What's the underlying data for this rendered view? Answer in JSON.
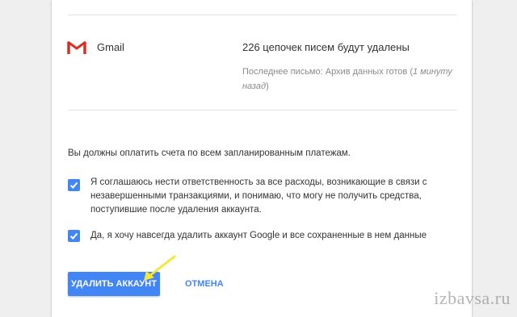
{
  "service": {
    "name": "Gmail",
    "count_text": "226 цепочек писем будут удалены",
    "last_prefix": "Последнее письмо: Архив данных готов (",
    "last_ago": "1 минуту назад",
    "last_suffix": ")"
  },
  "notice": "Вы должны оплатить счета по всем запланированным платежам.",
  "checkboxes": [
    {
      "label": "Я соглашаюсь нести ответственность за все расходы, возникающие в связи с незавершенными транзакциями, и понимаю, что могу не получить средства, поступившие после удаления аккаунта.",
      "checked": true
    },
    {
      "label": "Да, я хочу навсегда удалить аккаунт Google и все сохраненные в нем данные",
      "checked": true
    }
  ],
  "buttons": {
    "delete": "УДАЛИТЬ АККАУНТ",
    "cancel": "ОТМЕНА"
  },
  "watermark": "izbavsa.ru",
  "colors": {
    "accent": "#4285f4",
    "gmail_red": "#d93025",
    "arrow": "#f5e63a"
  }
}
